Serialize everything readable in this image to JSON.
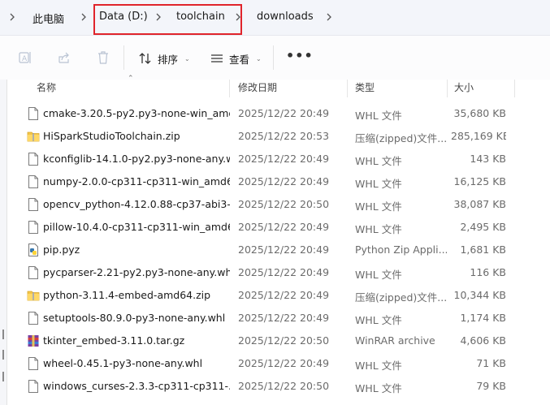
{
  "breadcrumb": {
    "items": [
      {
        "label": "此电脑"
      },
      {
        "label": "Data (D:)"
      },
      {
        "label": "toolchain"
      },
      {
        "label": "downloads"
      }
    ]
  },
  "toolbar": {
    "sort_label": "排序",
    "view_label": "查看",
    "more_label": "•••"
  },
  "columns": {
    "name": "名称",
    "date": "修改日期",
    "type": "类型",
    "size": "大小"
  },
  "files": [
    {
      "name": "cmake-3.20.5-py2.py3-none-win_amd...",
      "date": "2025/12/22 20:49",
      "type": "WHL 文件",
      "size": "35,680 KB",
      "icon": "file-icon"
    },
    {
      "name": "HiSparkStudioToolchain.zip",
      "date": "2025/12/22 20:53",
      "type": "压缩(zipped)文件...",
      "size": "285,169 KB",
      "icon": "zip-folder-icon"
    },
    {
      "name": "kconfiglib-14.1.0-py2.py3-none-any.w...",
      "date": "2025/12/22 20:49",
      "type": "WHL 文件",
      "size": "143 KB",
      "icon": "file-icon"
    },
    {
      "name": "numpy-2.0.0-cp311-cp311-win_amd6...",
      "date": "2025/12/22 20:49",
      "type": "WHL 文件",
      "size": "16,125 KB",
      "icon": "file-icon"
    },
    {
      "name": "opencv_python-4.12.0.88-cp37-abi3-...",
      "date": "2025/12/22 20:50",
      "type": "WHL 文件",
      "size": "38,087 KB",
      "icon": "file-icon"
    },
    {
      "name": "pillow-10.4.0-cp311-cp311-win_amd6...",
      "date": "2025/12/22 20:49",
      "type": "WHL 文件",
      "size": "2,495 KB",
      "icon": "file-icon"
    },
    {
      "name": "pip.pyz",
      "date": "2025/12/22 20:49",
      "type": "Python Zip Appli...",
      "size": "1,681 KB",
      "icon": "python-icon"
    },
    {
      "name": "pycparser-2.21-py2.py3-none-any.whl",
      "date": "2025/12/22 20:49",
      "type": "WHL 文件",
      "size": "116 KB",
      "icon": "file-icon"
    },
    {
      "name": "python-3.11.4-embed-amd64.zip",
      "date": "2025/12/22 20:49",
      "type": "压缩(zipped)文件...",
      "size": "10,344 KB",
      "icon": "zip-folder-icon"
    },
    {
      "name": "setuptools-80.9.0-py3-none-any.whl",
      "date": "2025/12/22 20:49",
      "type": "WHL 文件",
      "size": "1,174 KB",
      "icon": "file-icon"
    },
    {
      "name": "tkinter_embed-3.11.0.tar.gz",
      "date": "2025/12/22 20:50",
      "type": "WinRAR archive",
      "size": "4,606 KB",
      "icon": "winrar-icon"
    },
    {
      "name": "wheel-0.45.1-py3-none-any.whl",
      "date": "2025/12/22 20:49",
      "type": "WHL 文件",
      "size": "71 KB",
      "icon": "file-icon"
    },
    {
      "name": "windows_curses-2.3.3-cp311-cp311-...",
      "date": "2025/12/22 20:50",
      "type": "WHL 文件",
      "size": "79 KB",
      "icon": "file-icon"
    }
  ]
}
